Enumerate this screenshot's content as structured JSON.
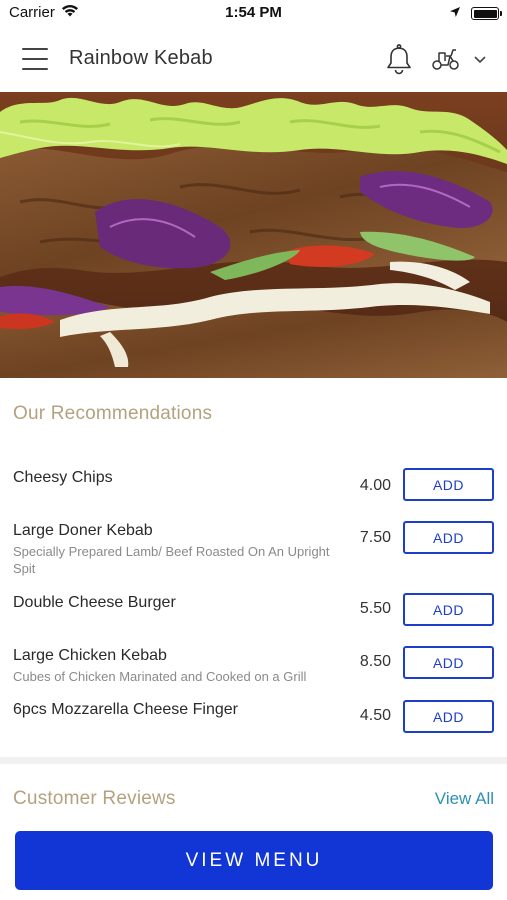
{
  "status_bar": {
    "carrier": "Carrier",
    "time": "1:54 PM"
  },
  "header": {
    "title": "Rainbow Kebab",
    "icons": [
      "hamburger-menu-icon",
      "bell-icon",
      "scooter-icon",
      "chevron-down-icon"
    ]
  },
  "hero": {
    "image": "doner-kebab-photo"
  },
  "recommendations": {
    "title": "Our Recommendations",
    "items": [
      {
        "name": "Cheesy Chips",
        "description": "",
        "price": "4.00",
        "button": "ADD"
      },
      {
        "name": "Large Doner Kebab",
        "description": "Specially Prepared Lamb/ Beef Roasted On An Upright Spit",
        "price": "7.50",
        "button": "ADD"
      },
      {
        "name": "Double Cheese Burger",
        "description": "",
        "price": "5.50",
        "button": "ADD"
      },
      {
        "name": "Large Chicken Kebab",
        "description": "Cubes of Chicken Marinated and Cooked on a Grill",
        "price": "8.50",
        "button": "ADD"
      },
      {
        "name": "6pcs Mozzarella Cheese Finger",
        "description": "",
        "price": "4.50",
        "button": "ADD"
      }
    ]
  },
  "reviews": {
    "title": "Customer Reviews",
    "view_all": "View All"
  },
  "footer": {
    "view_menu": "VIEW MENU"
  },
  "colors": {
    "accent_blue": "#1235d6",
    "section_title": "#b4a27f",
    "link": "#2f8fb4"
  }
}
